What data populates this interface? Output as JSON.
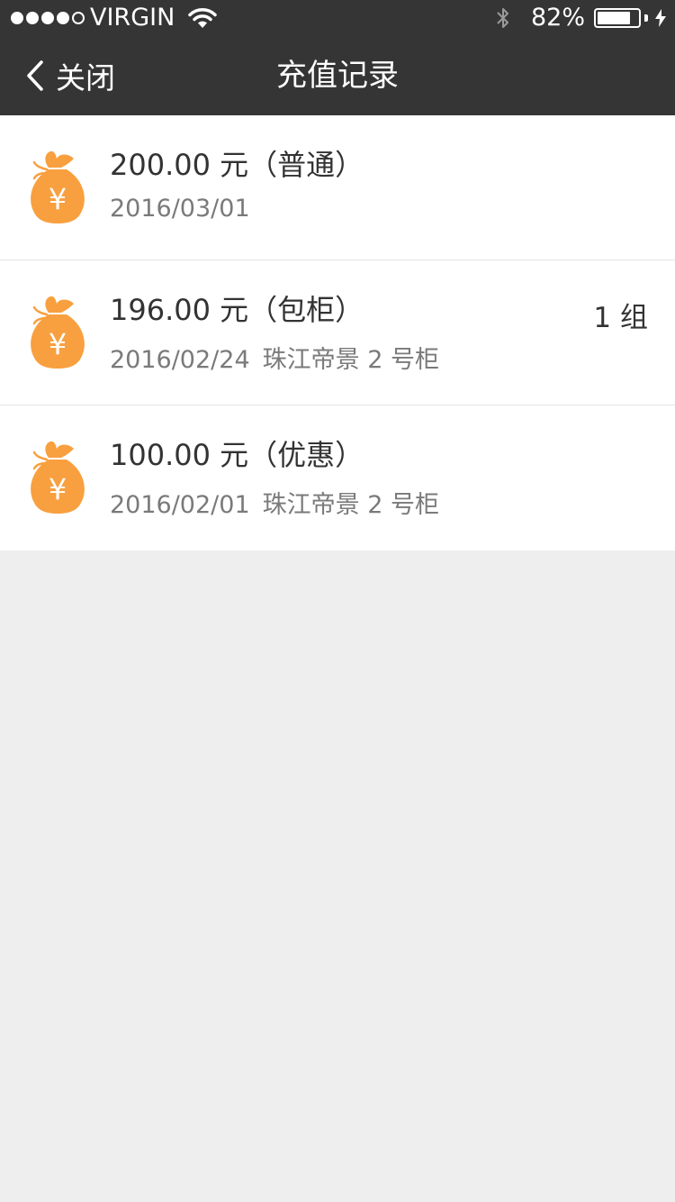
{
  "status_bar": {
    "carrier": "VIRGIN",
    "signal_bars_filled": 4,
    "signal_bars_total": 5,
    "battery_percent_label": "82%",
    "battery_level": 0.82
  },
  "nav": {
    "back_label": "关闭",
    "title": "充值记录"
  },
  "colors": {
    "header_bg": "#353535",
    "icon_orange": "#f8a03f",
    "page_bg": "#eeeeee"
  },
  "records": [
    {
      "amount": "200.00 元（普通）",
      "date": "2016/03/01",
      "location": "",
      "extra": ""
    },
    {
      "amount": "196.00 元（包柜）",
      "date": "2016/02/24",
      "location": "珠江帝景 2 号柜",
      "extra": "1 组"
    },
    {
      "amount": "100.00 元（优惠）",
      "date": "2016/02/01",
      "location": "珠江帝景 2 号柜",
      "extra": ""
    }
  ]
}
